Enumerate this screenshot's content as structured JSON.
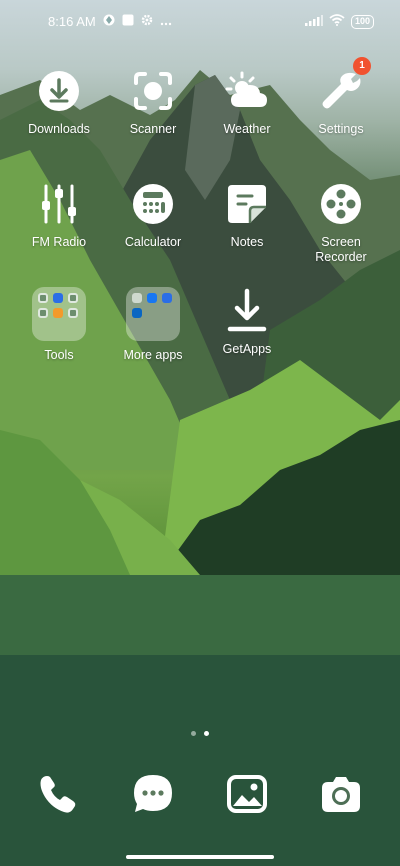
{
  "status_bar": {
    "time": "8:16 AM",
    "battery": "100"
  },
  "apps": [
    {
      "label": "Downloads",
      "icon": "download-icon"
    },
    {
      "label": "Scanner",
      "icon": "scanner-icon"
    },
    {
      "label": "Weather",
      "icon": "weather-icon"
    },
    {
      "label": "Settings",
      "icon": "wrench-icon",
      "badge": "1"
    },
    {
      "label": "FM Radio",
      "icon": "equalizer-icon"
    },
    {
      "label": "Calculator",
      "icon": "calculator-icon"
    },
    {
      "label": "Notes",
      "icon": "notes-icon"
    },
    {
      "label": "Screen\nRecorder",
      "icon": "film-reel-icon"
    },
    {
      "label": "Tools",
      "icon": "folder-icon"
    },
    {
      "label": "More apps",
      "icon": "folder-icon"
    },
    {
      "label": "GetApps",
      "icon": "get-apps-download-icon"
    }
  ],
  "page_indicator": {
    "pages": 2,
    "active": 2
  },
  "dock": [
    {
      "name": "phone",
      "icon": "phone-icon"
    },
    {
      "name": "messages",
      "icon": "chat-bubble-icon"
    },
    {
      "name": "gallery",
      "icon": "image-icon"
    },
    {
      "name": "camera",
      "icon": "camera-icon"
    }
  ],
  "colors": {
    "badge": "#f1522f",
    "icon": "#ffffff"
  }
}
